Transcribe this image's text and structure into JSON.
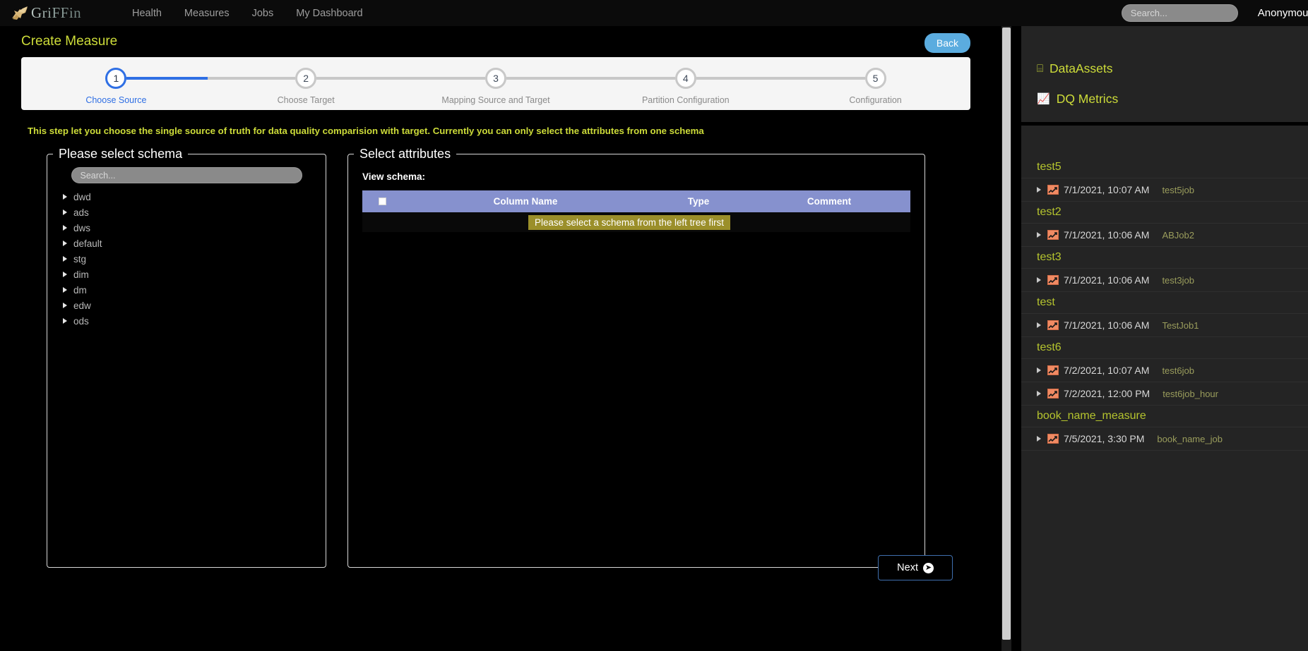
{
  "nav": {
    "brand": "GriFFin",
    "links": [
      "Health",
      "Measures",
      "Jobs",
      "My Dashboard"
    ],
    "search_placeholder": "Search...",
    "search_value": "",
    "user": "Anonymous"
  },
  "page": {
    "title": "Create Measure",
    "back_label": "Back",
    "next_label": "Next",
    "hint": "This step let you choose the single source of truth for data quality comparision with target. Currently you can only select the attributes from one schema"
  },
  "stepper": {
    "active_index": 0,
    "steps": [
      {
        "number": "1",
        "label": "Choose Source"
      },
      {
        "number": "2",
        "label": "Choose Target"
      },
      {
        "number": "3",
        "label": "Mapping Source and Target"
      },
      {
        "number": "4",
        "label": "Partition Configuration"
      },
      {
        "number": "5",
        "label": "Configuration"
      }
    ]
  },
  "schema_panel": {
    "legend": "Please select schema",
    "search_placeholder": "Search...",
    "search_value": "",
    "items": [
      "dwd",
      "ads",
      "dws",
      "default",
      "stg",
      "dim",
      "dm",
      "edw",
      "ods"
    ]
  },
  "attributes_panel": {
    "legend": "Select attributes",
    "view_schema_label": "View schema:",
    "columns": [
      "Column Name",
      "Type",
      "Comment"
    ],
    "empty_message": "Please select a schema from the left tree first",
    "rows": []
  },
  "sidebar": {
    "nav": [
      {
        "label": "DataAssets",
        "icon": "table-icon",
        "glyph": "⌸"
      },
      {
        "label": "DQ Metrics",
        "icon": "chart-line-icon",
        "glyph": "📈"
      }
    ],
    "groups": [
      {
        "title": "test5",
        "jobs": [
          {
            "time": "7/1/2021, 10:07 AM",
            "name": "test5job"
          }
        ]
      },
      {
        "title": "test2",
        "jobs": [
          {
            "time": "7/1/2021, 10:06 AM",
            "name": "ABJob2"
          }
        ]
      },
      {
        "title": "test3",
        "jobs": [
          {
            "time": "7/1/2021, 10:06 AM",
            "name": "test3job"
          }
        ]
      },
      {
        "title": "test",
        "jobs": [
          {
            "time": "7/1/2021, 10:06 AM",
            "name": "TestJob1"
          }
        ]
      },
      {
        "title": "test6",
        "jobs": [
          {
            "time": "7/2/2021, 10:07 AM",
            "name": "test6job"
          },
          {
            "time": "7/2/2021, 12:00 PM",
            "name": "test6job_hour"
          }
        ]
      },
      {
        "title": "book_name_measure",
        "jobs": [
          {
            "time": "7/5/2021, 3:30 PM",
            "name": "book_name_job"
          }
        ]
      }
    ]
  },
  "colors": {
    "accent_yellow": "#cddc39",
    "accent_blue": "#2f6fe4",
    "back_button": "#5bacdf",
    "table_header": "#8691ce",
    "empty_badge": "#9b8f2a",
    "job_icon": "#f08a63"
  }
}
